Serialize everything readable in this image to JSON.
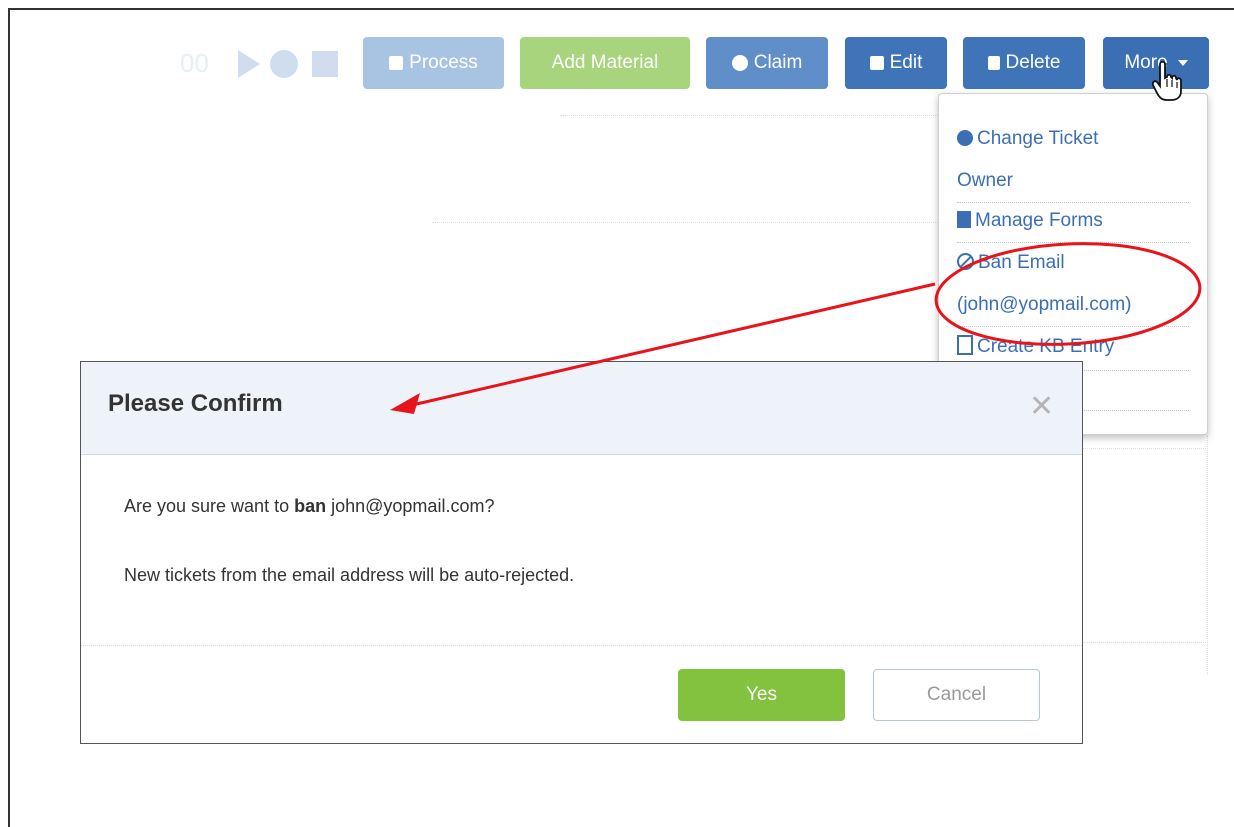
{
  "toolbar": {
    "timer_text": "00",
    "process_label": "Process",
    "add_material_label": "Add Material",
    "claim_label": "Claim",
    "edit_label": "Edit",
    "delete_label": "Delete",
    "more_label": "More"
  },
  "more_menu": {
    "items": [
      {
        "label_line1": "Change Ticket",
        "label_line2": "Owner",
        "icon": "user-circle-icon"
      },
      {
        "label": "Manage Forms",
        "icon": "copy-icon"
      },
      {
        "label_line1": "Ban Email",
        "label_line2": "(john@yopmail.com)",
        "icon": "ban-icon"
      },
      {
        "label": "Create KB Entry",
        "icon": "file-text-icon"
      }
    ]
  },
  "confirm_dialog": {
    "title": "Please Confirm",
    "message_prefix": "Are you sure want to ",
    "message_bold": "ban",
    "message_suffix": " john@yopmail.com?",
    "message_note": "New tickets from the email address will be auto-rejected.",
    "yes_label": "Yes",
    "cancel_label": "Cancel"
  },
  "colors": {
    "primary_blue": "#3f74b9",
    "green": "#82c23f",
    "annotation_red": "#e8141b"
  }
}
